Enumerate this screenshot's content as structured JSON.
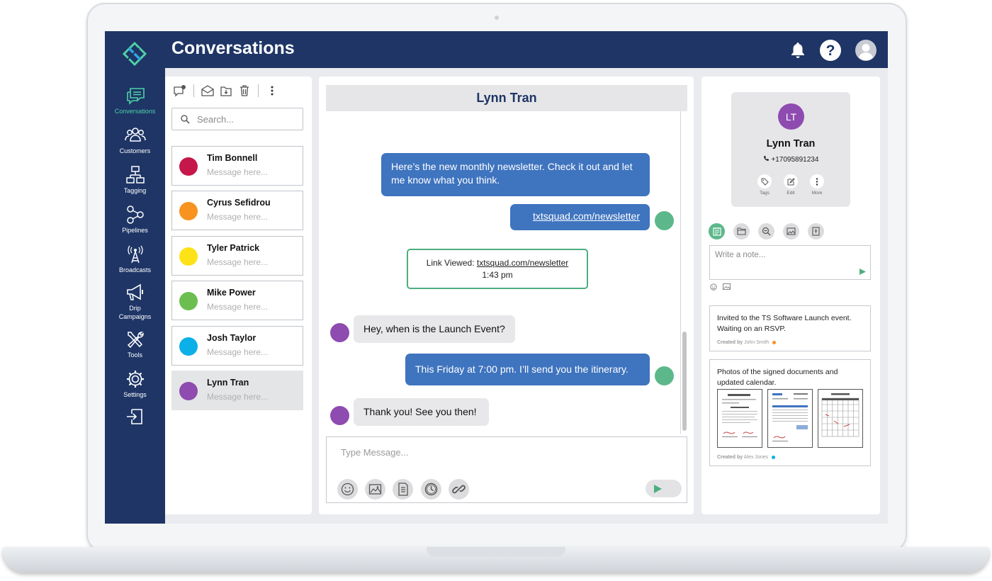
{
  "app": {
    "title": "Conversations"
  },
  "nav": {
    "items": [
      {
        "label": "Conversations",
        "icon": "chat-icon"
      },
      {
        "label": "Customers",
        "icon": "customers-icon"
      },
      {
        "label": "Tagging",
        "icon": "tagging-icon"
      },
      {
        "label": "Pipelines",
        "icon": "pipelines-icon"
      },
      {
        "label": "Broadcasts",
        "icon": "broadcast-icon"
      },
      {
        "label": "Drip Campaigns",
        "icon": "megaphone-icon"
      },
      {
        "label": "Tools",
        "icon": "tools-icon"
      },
      {
        "label": "Settings",
        "icon": "gear-icon"
      },
      {
        "label": "",
        "icon": "logout-icon"
      }
    ],
    "active": "Conversations"
  },
  "header": {
    "icons": [
      "bell-icon",
      "help-icon",
      "user-icon"
    ]
  },
  "search": {
    "placeholder": "Search..."
  },
  "contacts": [
    {
      "name": "Tim Bonnell",
      "preview": "Message here...",
      "color": "#c6174a"
    },
    {
      "name": "Cyrus Sefidrou",
      "preview": "Message here...",
      "color": "#f7931e"
    },
    {
      "name": "Tyler Patrick",
      "preview": "Message here...",
      "color": "#fde218"
    },
    {
      "name": "Mike Power",
      "preview": "Message here...",
      "color": "#6cbe51"
    },
    {
      "name": "Josh Taylor",
      "preview": "Message here...",
      "color": "#0cafe8"
    },
    {
      "name": "Lynn Tran",
      "preview": "Message here...",
      "color": "#8e4bb0"
    }
  ],
  "chat": {
    "contact_name": "Lynn Tran",
    "messages": [
      {
        "dir": "out",
        "text": "Here’s the new monthly newsletter. Check it out and let me know what you think."
      },
      {
        "dir": "out",
        "text": "txtsquad.com/newsletter",
        "link": true
      },
      {
        "dir": "event",
        "label": "Link Viewed:",
        "link": "txtsquad.com/newsletter",
        "time": "1:43 pm"
      },
      {
        "dir": "in",
        "text": "Hey, when is the Launch Event?"
      },
      {
        "dir": "out",
        "text": "This Friday at 7:00 pm. I’ll send you the itinerary."
      },
      {
        "dir": "in",
        "text": "Thank you! See you then!"
      }
    ],
    "composer_placeholder": "Type Message..."
  },
  "profile": {
    "initials": "LT",
    "name": "Lynn Tran",
    "phone": "+17095891234",
    "actions": [
      "Tags",
      "Edit",
      "More"
    ],
    "note_placeholder": "Write a note...",
    "notes": [
      {
        "text": "Invited to the TS Software Launch event. Waiting on an RSVP.",
        "created_label": "Created by",
        "author": "John Smith",
        "dot": "#f7931e"
      },
      {
        "text": "Photos of the signed documents and updated calendar.",
        "created_label": "Created by",
        "author": "Alex Jones",
        "dot": "#0cafe8",
        "attachments": 3
      }
    ]
  },
  "colors": {
    "navy": "#1e3566",
    "accent_green": "#4fd1a5",
    "bubble_blue": "#3f74bf",
    "contact_green": "#5cb88b"
  }
}
